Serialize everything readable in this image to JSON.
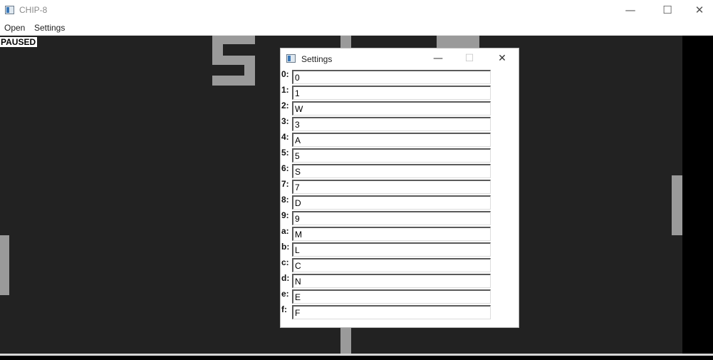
{
  "window": {
    "title": "CHIP-8",
    "minimize_glyph": "—",
    "maximize_glyph": "☐",
    "close_glyph": "✕"
  },
  "menu": {
    "items": [
      "Open",
      "Settings"
    ]
  },
  "status": {
    "paused": "PAUSED"
  },
  "settings_dialog": {
    "title": "Settings",
    "minimize_glyph": "—",
    "maximize_glyph": "☐",
    "close_glyph": "✕",
    "keys": [
      {
        "label": "0:",
        "value": "0"
      },
      {
        "label": "1:",
        "value": "1"
      },
      {
        "label": "2:",
        "value": "W"
      },
      {
        "label": "3:",
        "value": "3"
      },
      {
        "label": "4:",
        "value": "A"
      },
      {
        "label": "5:",
        "value": "5"
      },
      {
        "label": "6:",
        "value": "S"
      },
      {
        "label": "7:",
        "value": "7"
      },
      {
        "label": "8:",
        "value": "D"
      },
      {
        "label": "9:",
        "value": "9"
      },
      {
        "label": "a:",
        "value": "M"
      },
      {
        "label": "b:",
        "value": "L"
      },
      {
        "label": "c:",
        "value": "C"
      },
      {
        "label": "d:",
        "value": "N"
      },
      {
        "label": "e:",
        "value": "E"
      },
      {
        "label": "f:",
        "value": "F"
      }
    ]
  },
  "colors": {
    "canvas_background": "#222222",
    "pixel_on": "#9a9a9a"
  }
}
